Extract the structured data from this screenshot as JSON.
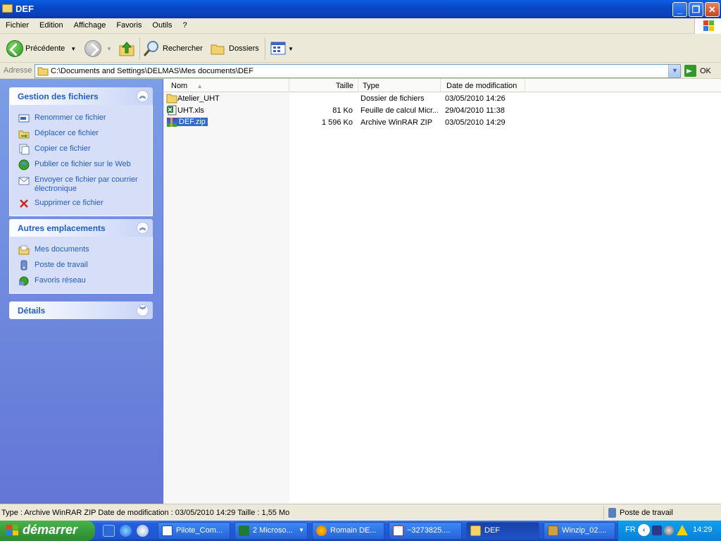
{
  "window": {
    "title": "DEF",
    "min": "_",
    "max": "❐",
    "close": "✕"
  },
  "menu": [
    "Fichier",
    "Edition",
    "Affichage",
    "Favoris",
    "Outils",
    "?"
  ],
  "toolbar": {
    "back": "Précédente",
    "search": "Rechercher",
    "folders": "Dossiers"
  },
  "address": {
    "label": "Adresse",
    "path": "C:\\Documents and Settings\\DELMAS\\Mes documents\\DEF",
    "go": "OK"
  },
  "taskpane": {
    "file_tasks": {
      "title": "Gestion des fichiers",
      "items": [
        "Renommer ce fichier",
        "Déplacer ce fichier",
        "Copier ce fichier",
        "Publier ce fichier sur le Web",
        "Envoyer ce fichier par courrier électronique",
        "Supprimer ce fichier"
      ]
    },
    "other_places": {
      "title": "Autres emplacements",
      "items": [
        "Mes documents",
        "Poste de travail",
        "Favoris réseau"
      ]
    },
    "details": {
      "title": "Détails"
    }
  },
  "columns": {
    "name": "Nom",
    "size": "Taille",
    "type": "Type",
    "date": "Date de modification"
  },
  "files": [
    {
      "name": "Atelier_UHT",
      "size": "",
      "type": "Dossier de fichiers",
      "date": "03/05/2010 14:26",
      "icon": "folder-icon"
    },
    {
      "name": "UHT.xls",
      "size": "81 Ko",
      "type": "Feuille de calcul Micr...",
      "date": "29/04/2010 11:38",
      "icon": "excel-file-icon"
    },
    {
      "name": "DEF.zip",
      "size": "1 596 Ko",
      "type": "Archive WinRAR ZIP",
      "date": "03/05/2010 14:29",
      "icon": "winrar-archive-icon",
      "selected": true
    }
  ],
  "status": {
    "left": "Type : Archive WinRAR ZIP Date de modification : 03/05/2010 14:29 Taille  : 1,55 Mo",
    "right": "Poste de travail"
  },
  "taskbar": {
    "start": "démarrer",
    "buttons": [
      "Pilote_Com...",
      "2 Microso...",
      "Romain DE...",
      "~3273825....",
      "DEF",
      "Winzip_02...."
    ],
    "lang": "FR",
    "clock": "14:29"
  }
}
